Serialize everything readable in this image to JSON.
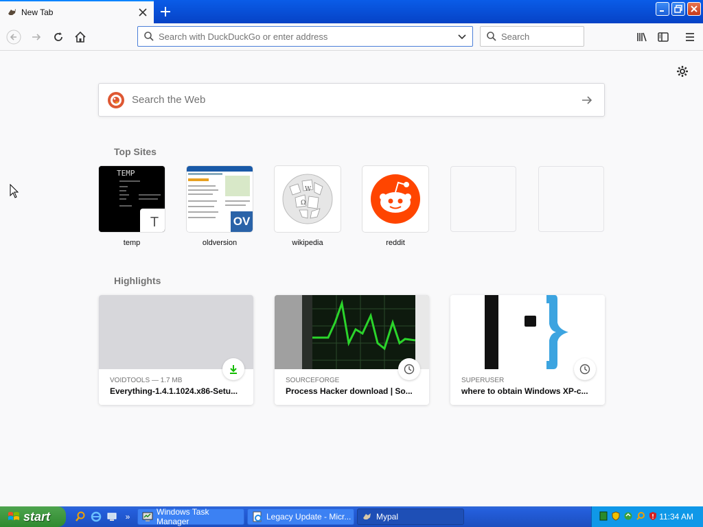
{
  "tab": {
    "title": "New Tab"
  },
  "toolbar": {
    "url_placeholder": "Search with DuckDuckGo or enter address",
    "search_placeholder": "Search"
  },
  "newtab": {
    "web_search_placeholder": "Search the Web",
    "top_sites_title": "Top Sites",
    "highlights_title": "Highlights",
    "top_sites": [
      {
        "label": "temp",
        "badge_letter": "T"
      },
      {
        "label": "oldversion",
        "badge_text": "OV"
      },
      {
        "label": "wikipedia"
      },
      {
        "label": "reddit"
      }
    ],
    "highlights": [
      {
        "meta": "VOIDTOOLS — 1.7 MB",
        "title": "Everything-1.4.1.1024.x86-Setu...",
        "badge_icon": "download-icon"
      },
      {
        "meta": "SOURCEFORGE",
        "title": "Process Hacker download | So...",
        "badge_icon": "clock-icon"
      },
      {
        "meta": "SUPERUSER",
        "title": "where to obtain Windows XP-c...",
        "badge_icon": "clock-icon"
      }
    ]
  },
  "taskbar": {
    "start_label": "start",
    "chevron": "»",
    "buttons": [
      {
        "label": "Windows Task Manager"
      },
      {
        "label": "Legacy Update - Micr..."
      },
      {
        "label": "Mypal"
      }
    ],
    "clock": "11:34 AM"
  },
  "colors": {
    "accent": "#0a84ff",
    "reddit": "#ff4500",
    "duckduckgo": "#de5833",
    "download_green": "#12bc00",
    "xp_blue": "#245edb",
    "xp_start_green": "#3c983c"
  }
}
